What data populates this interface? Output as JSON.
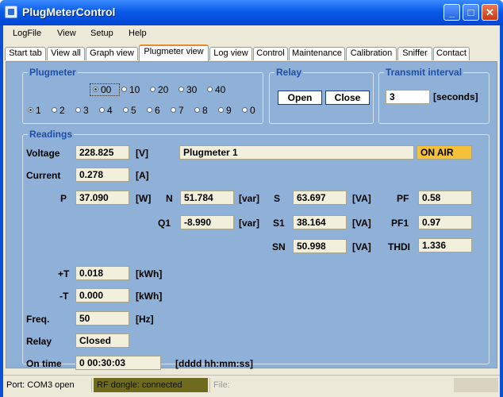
{
  "window": {
    "title": "PlugMeterControl",
    "minimize_glyph": "_",
    "maximize_glyph": "□",
    "close_glyph": "✕"
  },
  "menu": [
    "LogFile",
    "View",
    "Setup",
    "Help"
  ],
  "tabs": [
    "Start tab",
    "View all",
    "Graph view",
    "Plugmeter view",
    "Log view",
    "Control",
    "Maintenance",
    "Calibration",
    "Sniffer",
    "Contact"
  ],
  "active_tab": "Plugmeter view",
  "plugmeter": {
    "title": "Plugmeter",
    "tens": [
      "00",
      "10",
      "20",
      "30",
      "40"
    ],
    "tens_selected": "00",
    "units": [
      "1",
      "2",
      "3",
      "4",
      "5",
      "6",
      "7",
      "8",
      "9",
      "0"
    ],
    "units_selected": "1"
  },
  "relay": {
    "title": "Relay",
    "open_label": "Open",
    "close_label": "Close"
  },
  "transmit": {
    "title": "Transmit interval",
    "value": "3",
    "unit": "[seconds]"
  },
  "readings": {
    "title": "Readings",
    "voltage": {
      "label": "Voltage",
      "value": "228.825",
      "unit": "[V]"
    },
    "current": {
      "label": "Current",
      "value": "0.278",
      "unit": "[A]"
    },
    "p": {
      "label": "P",
      "value": "37.090",
      "unit": "[W]"
    },
    "n": {
      "label": "N",
      "value": "51.784",
      "unit": "[var]"
    },
    "q1": {
      "label": "Q1",
      "value": "-8.990",
      "unit": "[var]"
    },
    "s": {
      "label": "S",
      "value": "63.697",
      "unit": "[VA]"
    },
    "s1": {
      "label": "S1",
      "value": "38.164",
      "unit": "[VA]"
    },
    "sn": {
      "label": "SN",
      "value": "50.998",
      "unit": "[VA]"
    },
    "pf": {
      "label": "PF",
      "value": "0.58"
    },
    "pf1": {
      "label": "PF1",
      "value": "0.97"
    },
    "thdi": {
      "label": "THDI",
      "value": "1.336"
    },
    "plus_t": {
      "label": "+T",
      "value": "0.018",
      "unit": "[kWh]"
    },
    "minus_t": {
      "label": "-T",
      "value": "0.000",
      "unit": "[kWh]"
    },
    "freq": {
      "label": "Freq.",
      "value": "50",
      "unit": "[Hz]"
    },
    "relay_state": {
      "label": "Relay",
      "value": "Closed"
    },
    "on_time": {
      "label": "On time",
      "value": "0 00:30:03",
      "unit": "[dddd hh:mm:ss]"
    },
    "device_name": "Plugmeter 1",
    "air_status": "ON AIR"
  },
  "status": {
    "port": "Port: COM3 open",
    "dongle": "RF dongle:  connected",
    "file": "File:"
  },
  "colors": {
    "title_bar": "#0a5be8",
    "panel": "#8fb1d7",
    "group_title": "#1f4ea8",
    "field_bg": "#f2f0dc",
    "on_air": "#f5c03a",
    "dongle_connected": "#6f6b1e"
  }
}
